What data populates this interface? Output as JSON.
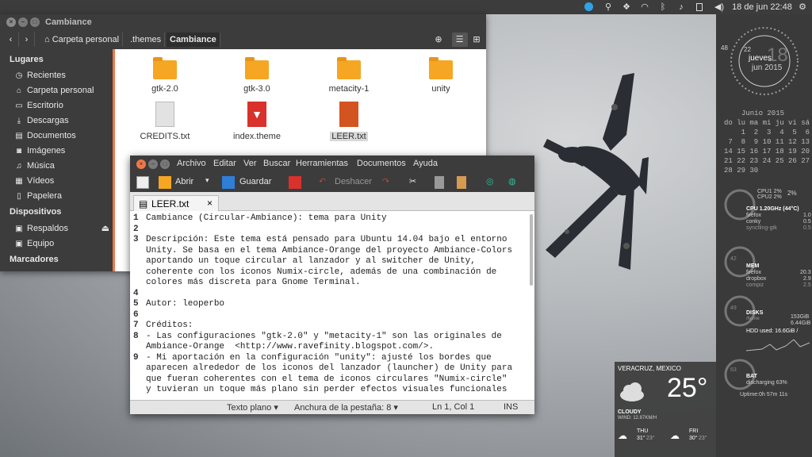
{
  "top_panel": {
    "datetime": "18 de jun 22:48"
  },
  "file_manager": {
    "title": "Cambiance",
    "breadcrumbs": [
      "Carpeta personal",
      ".themes",
      "Cambiance"
    ],
    "sidebar": {
      "places_header": "Lugares",
      "places": [
        "Recientes",
        "Carpeta personal",
        "Escritorio",
        "Descargas",
        "Documentos",
        "Imágenes",
        "Música",
        "Vídeos",
        "Papelera"
      ],
      "devices_header": "Dispositivos",
      "devices": [
        "Respaldos",
        "Equipo"
      ],
      "bookmarks_header": "Marcadores"
    },
    "files": [
      {
        "name": "gtk-2.0",
        "type": "folder"
      },
      {
        "name": "gtk-3.0",
        "type": "folder"
      },
      {
        "name": "metacity-1",
        "type": "folder"
      },
      {
        "name": "unity",
        "type": "folder"
      },
      {
        "name": "CREDITS.txt",
        "type": "text"
      },
      {
        "name": "index.theme",
        "type": "theme"
      },
      {
        "name": "LEER.txt",
        "type": "text-selected"
      }
    ]
  },
  "gedit": {
    "menus": [
      "Archivo",
      "Editar",
      "Ver",
      "Buscar",
      "Herramientas",
      "Documentos",
      "Ayuda"
    ],
    "toolbar": {
      "open_label": "Abrir",
      "save_label": "Guardar",
      "undo_label": "Deshacer"
    },
    "tab_label": "LEER.txt",
    "lines": [
      {
        "n": "1",
        "text": "Cambiance (Circular-Ambiance): tema para Unity"
      },
      {
        "n": "2",
        "text": ""
      },
      {
        "n": "3",
        "text": "Descripción: Este tema está pensado para Ubuntu 14.04 bajo el entorno"
      },
      {
        "n": "",
        "text": "Unity. Se basa en el tema Ambiance-Orange del proyecto Ambiance-Colors"
      },
      {
        "n": "",
        "text": "aportando un toque circular al lanzador y al switcher de Unity,"
      },
      {
        "n": "",
        "text": "coherente con los iconos Numix-circle, además de una combinación de"
      },
      {
        "n": "",
        "text": "colores más discreta para Gnome Terminal."
      },
      {
        "n": "4",
        "text": ""
      },
      {
        "n": "5",
        "text": "Autor: leoperbo"
      },
      {
        "n": "6",
        "text": ""
      },
      {
        "n": "7",
        "text": "Créditos:"
      },
      {
        "n": "8",
        "text": "- Las configuraciones \"gtk-2.0\" y \"metacity-1\" son las originales de"
      },
      {
        "n": "",
        "text": "Ambiance-Orange  <http://www.ravefinity.blogspot.com/>."
      },
      {
        "n": "9",
        "text": "- Mi aportación en la configuración \"unity\": ajusté los bordes que"
      },
      {
        "n": "",
        "text": "aparecen alrededor de los iconos del lanzador (launcher) de Unity para"
      },
      {
        "n": "",
        "text": "que fueran coherentes con el tema de iconos circulares \"Numix-circle\""
      },
      {
        "n": "",
        "text": "y tuvieran un toque más plano sin perder efectos visuales funcionales"
      }
    ],
    "status": {
      "syntax": "Texto plano",
      "tab_width": "Anchura de la pestaña: 8",
      "position": "Ln 1, Col 1",
      "mode": "INS"
    }
  },
  "conky": {
    "clock_day": "jueves",
    "clock_date": "jun 2015",
    "clock_bignum": "18",
    "clock_hour": "22",
    "clock_min": "48",
    "calendar_title": "Junio 2015",
    "calendar_header": "do lu ma mi ju vi sá",
    "calendar_rows": [
      "    1  2  3  4  5  6",
      " 7  8  9 10 11 12 13",
      "14 15 16 17 18 19 20",
      "21 22 23 24 25 26 27",
      "28 29 30"
    ],
    "cpu": {
      "cpu1": "CPU1 2%",
      "cpu2": "CPU2 2%",
      "total": "2%",
      "header": "CPU 1.20GHz (44°C)",
      "procs": [
        {
          "name": "firefox",
          "val": "1.0"
        },
        {
          "name": "conky",
          "val": "0.5"
        },
        {
          "name": "synctling-gtk",
          "val": "0.5"
        }
      ]
    },
    "mem": {
      "header": "MEM",
      "gauge": "42",
      "procs": [
        {
          "name": "firefox",
          "val": "20.3"
        },
        {
          "name": "dropbox",
          "val": "2.9"
        },
        {
          "name": "compiz",
          "val": "2.5"
        }
      ]
    },
    "disks": {
      "header": "DISKS",
      "gauge": "49",
      "home_label": "/home",
      "v1": "153GiB",
      "v2": "6.44GiB",
      "hdd": "HDD used: 16.6GiB /"
    },
    "bat": {
      "header": "BAT",
      "gauge": "63",
      "status": "discharging 63%",
      "uptime": "Uptime:0h 57m 11s"
    }
  },
  "weather": {
    "city": "VERACRUZ, MEXICO",
    "temp": "25°",
    "cond": "CLOUDY",
    "wind": "WIND: 12.87KM/H",
    "forecast": [
      {
        "day": "THU",
        "hi": "31°",
        "lo": "23°"
      },
      {
        "day": "FRI",
        "hi": "30°",
        "lo": "23°"
      }
    ]
  },
  "colors": {
    "accent": "#f07746",
    "folder": "#f5a623",
    "panel": "#3c3c3c"
  }
}
